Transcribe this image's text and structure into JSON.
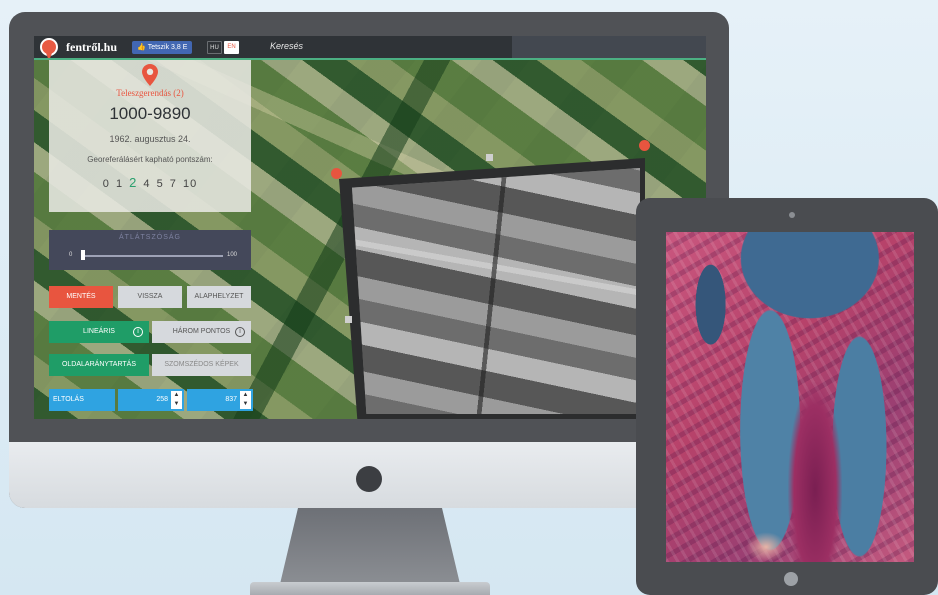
{
  "nav": {
    "logo_text": "fentről.hu",
    "like_label": "Tetszik 3,8 E",
    "lang_hu": "HU",
    "lang_en": "EN",
    "search_label": "Keresés"
  },
  "info": {
    "title": "Teleszgerendás (2)",
    "photo_id": "1000-9890",
    "date": "1962. augusztus 24.",
    "georef_label": "Georeferálásért kapható pontszám:",
    "points": [
      "0",
      "1",
      "2",
      "4",
      "5",
      "7",
      "10"
    ],
    "active_point": "2"
  },
  "opacity": {
    "label": "ÁTLÁTSZÓSÁG",
    "min": "0",
    "max": "100",
    "value": 0
  },
  "buttons": {
    "save": "MENTÉS",
    "back": "VISSZA",
    "reset": "ALAPHELYZET",
    "linear": "LINEÁRIS",
    "three_point": "HÁROM PONTOS",
    "info_symbol": "i",
    "aspect": "OLDALARÁNYTARTÁS",
    "neighbors": "SZOMSZÉDOS KÉPEK",
    "shift": "ELTOLÁS"
  },
  "shift": {
    "x_value": "258",
    "y_value": "837"
  },
  "colors": {
    "accent_red": "#e8553f",
    "accent_green": "#1f9d67",
    "accent_blue": "#2fa3e1",
    "nav_dark": "#2f3337"
  },
  "icons": {
    "logo": "map-pin-logo-icon",
    "like": "thumbs-up-icon",
    "location": "map-pin-icon",
    "stepper": "up-down-arrows-icon"
  }
}
